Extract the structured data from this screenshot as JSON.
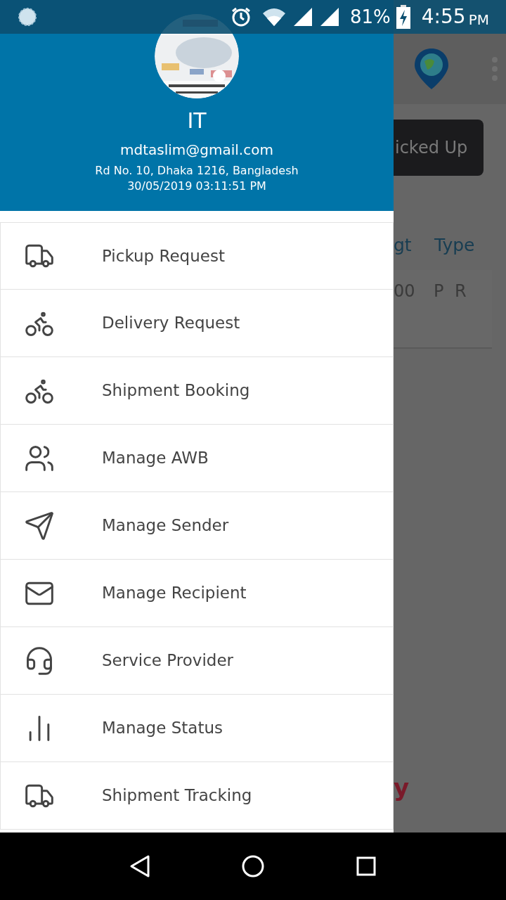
{
  "status_bar": {
    "battery": "81%",
    "time": "4:55",
    "meridiem": "PM"
  },
  "drawer": {
    "name": "IT",
    "email": "mdtaslim@gmail.com",
    "address": "Rd No. 10, Dhaka 1216, Bangladesh",
    "timestamp": "30/05/2019 03:11:51 PM",
    "items": [
      {
        "label": "Pickup Request"
      },
      {
        "label": "Delivery Request"
      },
      {
        "label": "Shipment Booking"
      },
      {
        "label": "Manage AWB"
      },
      {
        "label": "Manage Sender"
      },
      {
        "label": "Manage Recipient"
      },
      {
        "label": "Service Provider"
      },
      {
        "label": "Manage Status"
      },
      {
        "label": "Shipment Tracking"
      }
    ]
  },
  "background": {
    "button": "icked Up",
    "columns": [
      "gt",
      "Type"
    ],
    "row": [
      "00",
      "P R"
    ],
    "footer_text": "y"
  }
}
